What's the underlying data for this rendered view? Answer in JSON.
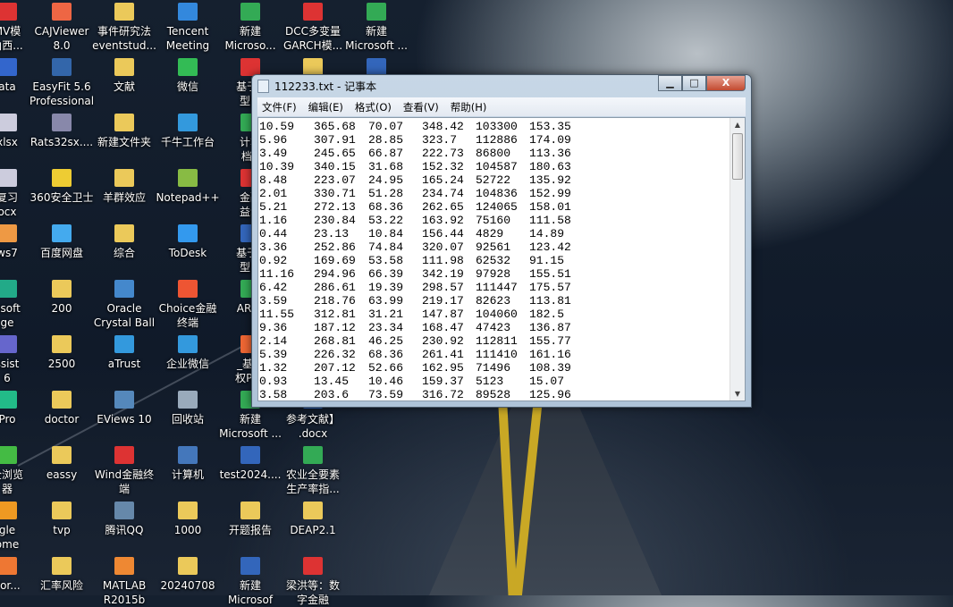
{
  "desktop": {
    "columns": [
      [
        {
          "label": "MV模\n山西...",
          "c": "#d33"
        },
        {
          "label": "ata",
          "c": "#36c"
        },
        {
          "label": "xlsx",
          "c": "#ccd"
        },
        {
          "label": "复习\nocx",
          "c": "#ccd"
        },
        {
          "label": "ws7",
          "c": "#e94"
        },
        {
          "label": "osoft\nge",
          "c": "#2a8"
        },
        {
          "label": "ssist\n6",
          "c": "#66c"
        },
        {
          "label": "Pro",
          "c": "#2b8"
        },
        {
          "label": "全浏览\n器",
          "c": "#4b4"
        },
        {
          "label": "gle\nome",
          "c": "#e92"
        },
        {
          "label": "Por...",
          "c": "#e73"
        }
      ],
      [
        {
          "label": "CAJViewer\n8.0",
          "c": "#e64"
        },
        {
          "label": "EasyFit 5.6\nProfessional",
          "c": "#36a"
        },
        {
          "label": "Rats32sx....",
          "c": "#88a"
        },
        {
          "label": "360安全卫士",
          "c": "#ec3"
        },
        {
          "label": "百度网盘",
          "c": "#4ae"
        },
        {
          "label": "200",
          "c": "#ebc95a"
        },
        {
          "label": "2500",
          "c": "#ebc95a"
        },
        {
          "label": "doctor",
          "c": "#ebc95a"
        },
        {
          "label": "eassy",
          "c": "#ebc95a"
        },
        {
          "label": "tvp",
          "c": "#ebc95a"
        },
        {
          "label": "汇率风险",
          "c": "#ebc95a"
        }
      ],
      [
        {
          "label": "事件研究法\neventstud...",
          "c": "#ebc95a"
        },
        {
          "label": "文献",
          "c": "#ebc95a"
        },
        {
          "label": "新建文件夹",
          "c": "#ebc95a"
        },
        {
          "label": "羊群效应",
          "c": "#ebc95a"
        },
        {
          "label": "综合",
          "c": "#ebc95a"
        },
        {
          "label": "Oracle\nCrystal Ball",
          "c": "#48c"
        },
        {
          "label": "aTrust",
          "c": "#39d"
        },
        {
          "label": "EViews 10",
          "c": "#58b"
        },
        {
          "label": "Wind金融终\n端",
          "c": "#d33"
        },
        {
          "label": "腾讯QQ",
          "c": "#68a"
        },
        {
          "label": "MATLAB\nR2015b",
          "c": "#e83"
        }
      ],
      [
        {
          "label": "Tencent\nMeeting",
          "c": "#38d"
        },
        {
          "label": "微信",
          "c": "#3b5"
        },
        {
          "label": "千牛工作台",
          "c": "#39d"
        },
        {
          "label": "Notepad++",
          "c": "#8b4"
        },
        {
          "label": "ToDesk",
          "c": "#39e"
        },
        {
          "label": "Choice金融\n终端",
          "c": "#e53"
        },
        {
          "label": "企业微信",
          "c": "#39d"
        },
        {
          "label": "回收站",
          "c": "#9ab"
        },
        {
          "label": "计算机",
          "c": "#47b"
        },
        {
          "label": "1000",
          "c": "#ebc95a"
        },
        {
          "label": "20240708",
          "c": "#ebc95a"
        }
      ],
      [
        {
          "label": "新建\nMicroso...",
          "c": "#3a5"
        },
        {
          "label": "基于K\n型的",
          "c": "#d33"
        },
        {
          "label": "计算\n档 -",
          "c": "#3a5"
        },
        {
          "label": "金融\n益动",
          "c": "#d33"
        },
        {
          "label": "基于K\n型的",
          "c": "#36b"
        },
        {
          "label": "ARIM",
          "c": "#3a5"
        },
        {
          "label": "_基于\n权PPP",
          "c": "#e63"
        },
        {
          "label": "新建\nMicrosoft ...",
          "c": "#3a5"
        },
        {
          "label": "test2024....",
          "c": "#36b"
        },
        {
          "label": "开题报告",
          "c": "#ebc95a"
        },
        {
          "label": "新建\nMicrosof",
          "c": "#36b"
        }
      ],
      [
        {
          "label": "DCC多变量\nGARCH模...",
          "c": "#d33"
        },
        {
          "label": "",
          "c": "#ebc95a"
        },
        null,
        null,
        null,
        null,
        null,
        {
          "label": "参考文献】\n.docx",
          "c": "#36b"
        },
        {
          "label": "农业全要素\n生产率指...",
          "c": "#3a5"
        },
        {
          "label": "DEAP2.1",
          "c": "#ebc95a"
        },
        {
          "label": "梁洪等：数\n字金融",
          "c": "#d33"
        }
      ],
      [
        {
          "label": "新建\nMicrosoft ...",
          "c": "#3a5"
        },
        {
          "label": "",
          "c": "#36b"
        }
      ]
    ]
  },
  "notepad": {
    "title": "112233.txt - 记事本",
    "controls": {
      "minimize": "▁",
      "maximize": "□",
      "close": "X"
    },
    "menu": [
      "文件(F)",
      "编辑(E)",
      "格式(O)",
      "查看(V)",
      "帮助(H)"
    ],
    "rows": [
      [
        "10.59",
        "365.68",
        "70.07",
        "348.42",
        "103300",
        "153.35"
      ],
      [
        "5.96",
        "307.91",
        "28.85",
        "323.7",
        "112886",
        "174.09"
      ],
      [
        "3.49",
        "245.65",
        "66.87",
        "222.73",
        "86800",
        "113.36"
      ],
      [
        "10.39",
        "340.15",
        "31.68",
        "152.32",
        "104587",
        "180.63"
      ],
      [
        "8.48",
        "223.07",
        "24.95",
        "165.24",
        "52722",
        "135.92"
      ],
      [
        "2.01",
        "330.71",
        "51.28",
        "234.74",
        "104836",
        "152.99"
      ],
      [
        "5.21",
        "272.13",
        "68.36",
        "262.65",
        "124065",
        "158.01"
      ],
      [
        "1.16",
        "230.84",
        "53.22",
        "163.92",
        "75160",
        "111.58"
      ],
      [
        "0.44",
        "23.13",
        "10.84",
        "156.44",
        "4829",
        "14.89"
      ],
      [
        "3.36",
        "252.86",
        "74.84",
        "320.07",
        "92561",
        "123.42"
      ],
      [
        "0.92",
        "169.69",
        "53.58",
        "111.98",
        "62532",
        "91.15"
      ],
      [
        "11.16",
        "294.96",
        "66.39",
        "342.19",
        "97928",
        "155.51"
      ],
      [
        "6.42",
        "286.61",
        "19.39",
        "298.57",
        "111447",
        "175.57"
      ],
      [
        "3.59",
        "218.76",
        "63.99",
        "219.17",
        "82623",
        "113.81"
      ],
      [
        "11.55",
        "312.81",
        "31.21",
        "147.87",
        "104060",
        "182.5"
      ],
      [
        "9.36",
        "187.12",
        "23.34",
        "168.47",
        "47423",
        "136.87"
      ],
      [
        "2.14",
        "268.81",
        "46.25",
        "230.92",
        "112811",
        "155.77"
      ],
      [
        "5.39",
        "226.32",
        "68.36",
        "261.41",
        "111410",
        "161.16"
      ],
      [
        "1.32",
        "207.12",
        "52.66",
        "162.95",
        "71496",
        "108.39"
      ],
      [
        "0.93",
        "13.45",
        "10.46",
        "159.37",
        "5123",
        "15.07"
      ],
      [
        "3.58",
        "203.6",
        "73.59",
        "316.72",
        "89528",
        "125.96"
      ]
    ]
  }
}
